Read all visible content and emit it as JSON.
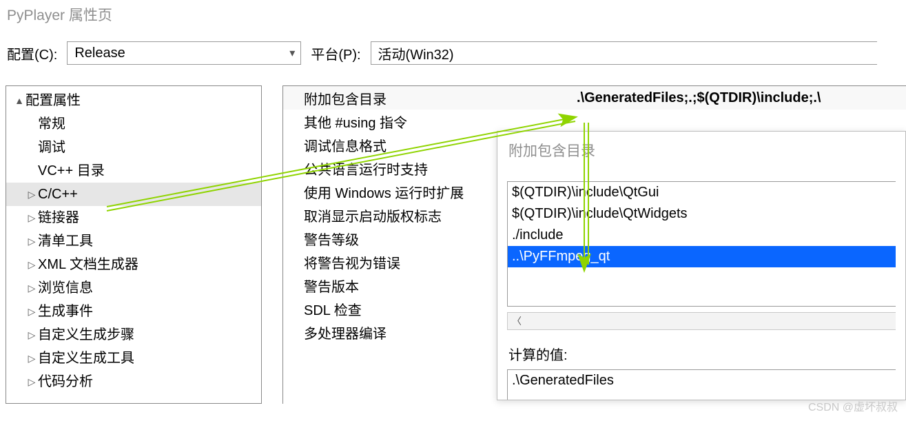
{
  "window": {
    "title": "PyPlayer 属性页"
  },
  "toolbar": {
    "config_label": "配置(C):",
    "config_value": "Release",
    "platform_label": "平台(P):",
    "platform_value": "活动(Win32)"
  },
  "tree": {
    "root": "配置属性",
    "items": [
      {
        "label": "常规",
        "twisty": ""
      },
      {
        "label": "调试",
        "twisty": ""
      },
      {
        "label": "VC++ 目录",
        "twisty": ""
      },
      {
        "label": "C/C++",
        "twisty": "▷",
        "selected": true
      },
      {
        "label": "链接器",
        "twisty": "▷"
      },
      {
        "label": "清单工具",
        "twisty": "▷"
      },
      {
        "label": "XML 文档生成器",
        "twisty": "▷"
      },
      {
        "label": "浏览信息",
        "twisty": "▷"
      },
      {
        "label": "生成事件",
        "twisty": "▷"
      },
      {
        "label": "自定义生成步骤",
        "twisty": "▷"
      },
      {
        "label": "自定义生成工具",
        "twisty": "▷"
      },
      {
        "label": "代码分析",
        "twisty": "▷"
      }
    ]
  },
  "props": {
    "rows": [
      {
        "label": "附加包含目录",
        "value": ".\\GeneratedFiles;.;$(QTDIR)\\include;.\\",
        "selected": true
      },
      {
        "label": "其他 #using 指令",
        "value": ""
      },
      {
        "label": "调试信息格式",
        "value": ""
      },
      {
        "label": "公共语言运行时支持",
        "value": ""
      },
      {
        "label": "使用 Windows 运行时扩展",
        "value": ""
      },
      {
        "label": "取消显示启动版权标志",
        "value": ""
      },
      {
        "label": "警告等级",
        "value": ""
      },
      {
        "label": "将警告视为错误",
        "value": ""
      },
      {
        "label": "警告版本",
        "value": ""
      },
      {
        "label": "SDL 检查",
        "value": ""
      },
      {
        "label": "多处理器编译",
        "value": ""
      }
    ]
  },
  "popup": {
    "title": "附加包含目录",
    "items": [
      "$(QTDIR)\\include\\QtGui",
      "$(QTDIR)\\include\\QtWidgets",
      "./include",
      "..\\PyFFmpeg_qt"
    ],
    "selected_index": 3,
    "calc_label": "计算的值:",
    "calc_value": ".\\GeneratedFiles"
  },
  "watermark": "CSDN @虚坏叔叔"
}
